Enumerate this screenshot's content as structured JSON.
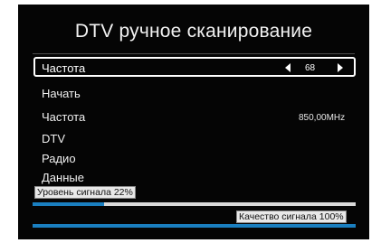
{
  "title": "DTV ручное сканирование",
  "rows": {
    "frequency_selector": {
      "label": "Частота",
      "value": "68",
      "left_arrow_icon": "triangle-left-icon",
      "right_arrow_icon": "triangle-right-icon"
    },
    "start": {
      "label": "Начать"
    },
    "frequency_info": {
      "label": "Частота",
      "value": "850,00MHz"
    },
    "dtv": {
      "label": "DTV"
    },
    "radio": {
      "label": "Радио"
    },
    "data": {
      "label": "Данные"
    }
  },
  "signal_level": {
    "label": "Уровень сигнала 22%",
    "percent": 22
  },
  "signal_quality": {
    "label": "Качество сигнала 100%",
    "percent": 100
  },
  "colors": {
    "background": "#050505",
    "accent": "#1a7fc0",
    "track": "#d9d9d9"
  }
}
